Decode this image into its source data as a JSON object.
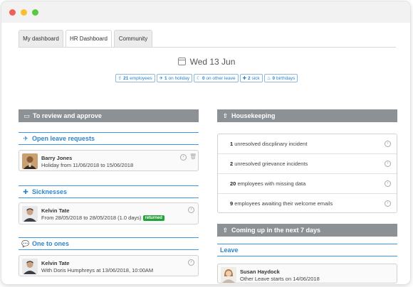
{
  "tabs": [
    {
      "label": "My dashboard"
    },
    {
      "label": "HR Dashboard"
    },
    {
      "label": "Community"
    }
  ],
  "date": "Wed 13 Jun",
  "stats": [
    {
      "count": "21",
      "label": "employees",
      "icon": "person-up-icon"
    },
    {
      "count": "1",
      "label": "on holiday",
      "icon": "plane-icon"
    },
    {
      "count": "0",
      "label": "on other leave",
      "icon": "moon-icon"
    },
    {
      "count": "2",
      "label": "sick",
      "icon": "medkit-icon"
    },
    {
      "count": "0",
      "label": "birthdays",
      "icon": "cake-icon"
    }
  ],
  "review": {
    "title": "To review and approve",
    "leave": {
      "title": "Open leave requests",
      "item": {
        "name": "Barry Jones",
        "detail": "Holiday from 11/06/2018 to 15/06/2018"
      }
    },
    "sick": {
      "title": "Sicknesses",
      "item": {
        "name": "Kelvin Tate",
        "detail": "From 28/05/2018 to 28/05/2018 (1.0 days)",
        "badge": "returned"
      }
    },
    "one_to_ones": {
      "title": "One to ones",
      "item": {
        "name": "Kelvin Tate",
        "detail": "With Doris Humphreys at 13/06/2018, 10:00AM"
      }
    }
  },
  "housekeeping": {
    "title": "Housekeeping",
    "items": [
      {
        "count": "1",
        "text": "unresolved discplinary incident"
      },
      {
        "count": "2",
        "text": "unresolved grievance incidents"
      },
      {
        "count": "20",
        "text": "employees with missing data"
      },
      {
        "count": "9",
        "text": "employees awaiting their welcome emails"
      }
    ]
  },
  "coming_up": {
    "title": "Coming up in the next 7 days",
    "leave_title": "Leave",
    "item": {
      "name": "Susan Haydock",
      "detail": "Other Leave starts on 14/06/2018"
    }
  },
  "colors": {
    "accent": "#2f86cf",
    "panel": "#8c9196",
    "returned": "#21a33a"
  }
}
